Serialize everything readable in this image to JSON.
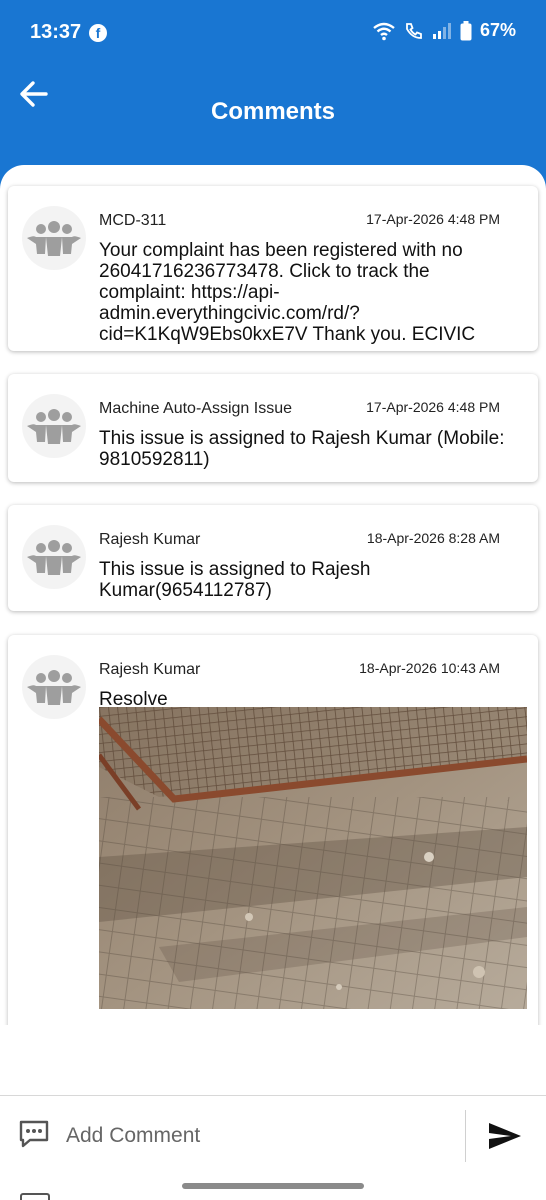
{
  "status_bar": {
    "time": "13:37",
    "app_badge": "f",
    "battery": "67%"
  },
  "header": {
    "title": "Comments"
  },
  "comments": [
    {
      "author": "MCD-311",
      "date": "17-Apr-2026 4:48 PM",
      "text": "Your complaint has been registered with no 26041716236773478. Click to track the complaint: https://api-admin.everythingcivic.com/rd/?cid=K1KqW9Ebs0kxE7V Thank you. ECIVIC"
    },
    {
      "author": "Machine Auto-Assign Issue",
      "date": "17-Apr-2026 4:48 PM",
      "text": "This issue is assigned to Rajesh Kumar (Mobile: 9810592811)"
    },
    {
      "author": "Rajesh Kumar",
      "date": "18-Apr-2026 8:28 AM",
      "text": "This issue is assigned to Rajesh Kumar(9654112787)"
    },
    {
      "author": "Rajesh Kumar",
      "date": "18-Apr-2026 10:43 AM",
      "text": "Resolve"
    }
  ],
  "composer": {
    "placeholder": "Add Comment"
  },
  "icons": {
    "back": "arrow-left-icon",
    "avatar": "group-people-icon",
    "chat": "chat-bubble-icon",
    "send": "send-icon"
  },
  "colors": {
    "header_bg": "#1976d2",
    "avatar_figure": "#9e9e9e"
  }
}
